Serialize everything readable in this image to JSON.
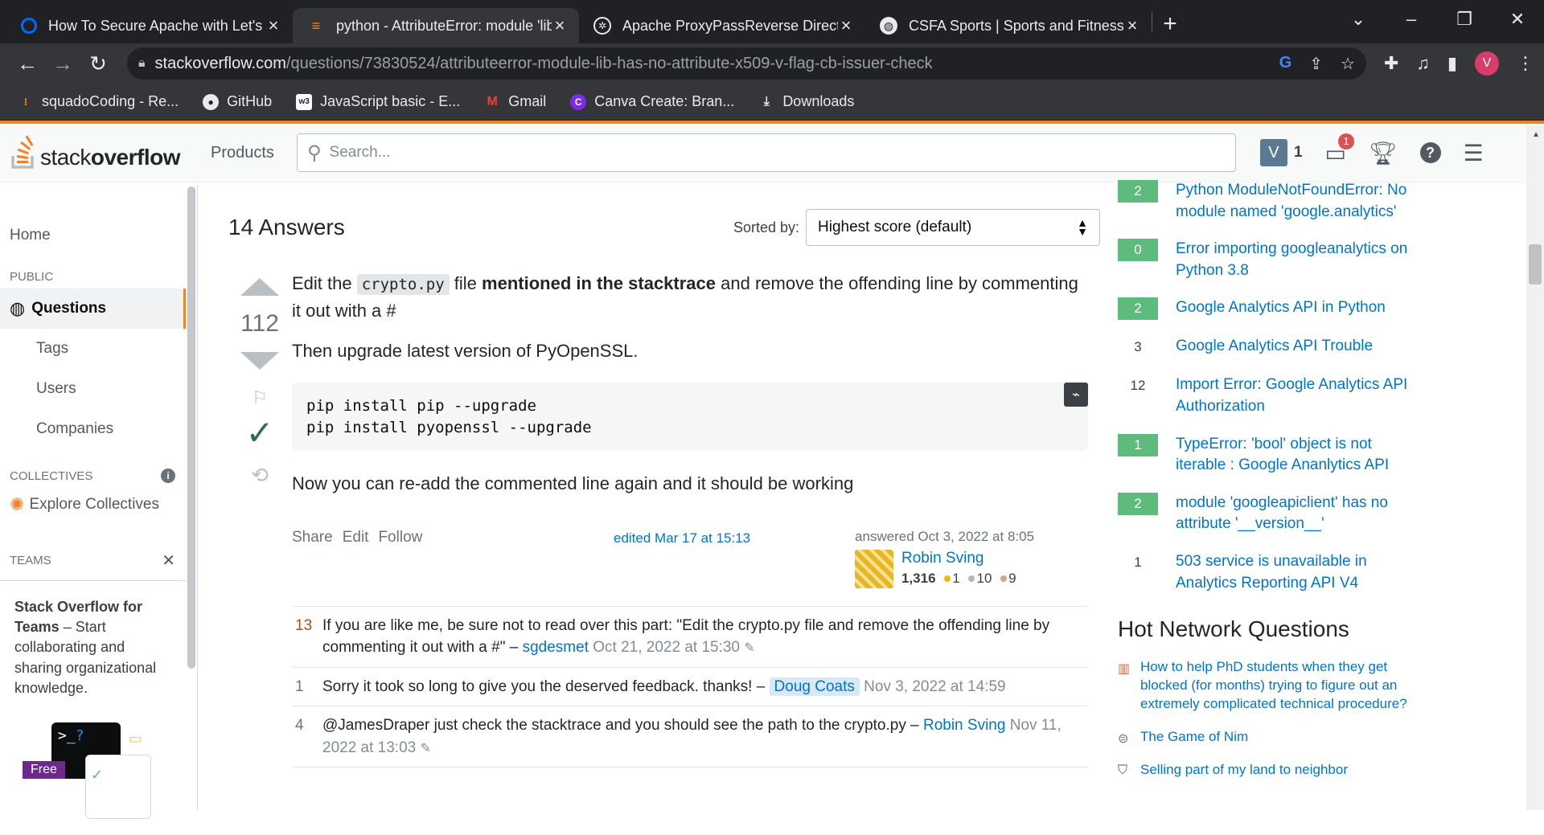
{
  "browser": {
    "tabs": [
      {
        "title": "How To Secure Apache with Let's Encrypt on Ubuntu",
        "favicon": "digitalocean-icon",
        "color": "#0069ff"
      },
      {
        "title": "python - AttributeError: module 'lib' has no attribute",
        "favicon": "stackoverflow-icon",
        "color": "#f48225"
      },
      {
        "title": "Apache ProxyPassReverse Directive",
        "favicon": "openai-icon",
        "color": "#e8eaed"
      },
      {
        "title": "CSFA Sports | Sports and Fitness Academy",
        "favicon": "globe-icon",
        "color": "#e8eaed"
      }
    ],
    "url_host": "stackoverflow.com",
    "url_path": "/questions/73830524/attributeerror-module-lib-has-no-attribute-x509-v-flag-cb-issuer-check",
    "profile_initial": "V",
    "bookmarks": [
      {
        "label": "squadoCoding - Re...",
        "icon": "squado-icon"
      },
      {
        "label": "GitHub",
        "icon": "github-icon"
      },
      {
        "label": "JavaScript basic - E...",
        "icon": "w3-icon"
      },
      {
        "label": "Gmail",
        "icon": "gmail-icon"
      },
      {
        "label": "Canva Create: Bran...",
        "icon": "canva-icon"
      },
      {
        "label": "Downloads",
        "icon": "download-icon"
      }
    ]
  },
  "topbar": {
    "logo_light": "stack",
    "logo_bold": "overflow",
    "products": "Products",
    "search_placeholder": "Search...",
    "avatar_initial": "V",
    "reputation": "1",
    "inbox_count": "1"
  },
  "leftnav": {
    "home": "Home",
    "public": "PUBLIC",
    "questions": "Questions",
    "tags": "Tags",
    "users": "Users",
    "companies": "Companies",
    "collectives": "COLLECTIVES",
    "explore_collectives": "Explore Collectives",
    "teams": "TEAMS",
    "teams_title": "Stack Overflow for Teams",
    "teams_text": " – Start collaborating and sharing organizational knowledge.",
    "free": "Free"
  },
  "answers": {
    "count_label": "14 Answers",
    "sorted_by": "Sorted by:",
    "sort_value": "Highest score (default)"
  },
  "answer": {
    "score": "112",
    "p1_a": "Edit the ",
    "p1_code": "crypto.py",
    "p1_b": " file ",
    "p1_bold": "mentioned in the stacktrace",
    "p1_c": " and remove the offending line by commenting it out with a #",
    "p2": "Then upgrade latest version of PyOpenSSL.",
    "code_line1": "pip install pip --upgrade",
    "code_line2": "pip install pyopenssl --upgrade",
    "p3": "Now you can re-add the commented line again and it should be working",
    "share": "Share",
    "edit": "Edit",
    "follow": "Follow",
    "edited": "edited Mar 17 at 15:13",
    "answered": "answered Oct 3, 2022 at 8:05",
    "user_name": "Robin Sving",
    "user_rep": "1,316",
    "gold": "1",
    "silver": "10",
    "bronze": "9"
  },
  "comments": [
    {
      "score": "13",
      "text": "If you are like me, be sure not to read over this part: \"Edit the crypto.py file and remove the offending line by commenting it out with a #\" – ",
      "user": "sgdesmet",
      "date": "Oct 21, 2022 at 15:30",
      "edit_icon": "pencil-icon"
    },
    {
      "score": "1",
      "text": "Sorry it took so long to give you the deserved feedback. thanks! – ",
      "user": "Doug Coats",
      "date": "Nov 3, 2022 at 14:59"
    },
    {
      "score": "4",
      "text": "@JamesDraper just check the stacktrace and you should see the path to the crypto.py – ",
      "user": "Robin Sving",
      "date": "Nov 11, 2022 at 13:03",
      "edit_icon": "pencil-icon"
    }
  ],
  "related": [
    {
      "score": "2",
      "answered": true,
      "title": "Python ModuleNotFoundError: No module named 'google.analytics'"
    },
    {
      "score": "0",
      "answered": true,
      "title": "Error importing googleanalytics on Python 3.8"
    },
    {
      "score": "2",
      "answered": true,
      "title": "Google Analytics API in Python"
    },
    {
      "score": "3",
      "answered": false,
      "title": "Google Analytics API Trouble"
    },
    {
      "score": "12",
      "answered": false,
      "title": "Import Error: Google Analytics API Authorization"
    },
    {
      "score": "1",
      "answered": true,
      "title": "TypeError: 'bool' object is not iterable : Google Ananlytics API"
    },
    {
      "score": "2",
      "answered": true,
      "title": "module 'googleapiclient' has no attribute '__version__'"
    },
    {
      "score": "1",
      "answered": false,
      "title": "503 service is unavailable in Analytics Reporting API V4"
    }
  ],
  "hot": {
    "title": "Hot Network Questions",
    "items": [
      {
        "icon": "academia-icon",
        "title": "How to help PhD students when they get blocked (for months) trying to figure out an extremely complicated technical procedure?"
      },
      {
        "icon": "puzzling-icon",
        "title": "The Game of Nim"
      },
      {
        "icon": "law-icon",
        "title": "Selling part of my land to neighbor"
      }
    ]
  }
}
